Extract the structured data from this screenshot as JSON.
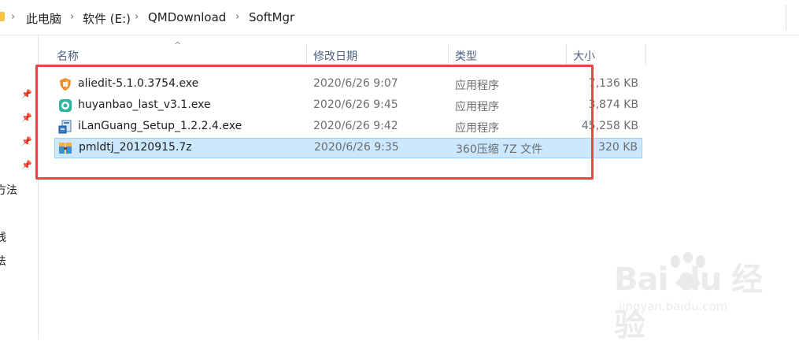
{
  "breadcrumb": {
    "items": [
      "此电脑",
      "软件 (E:)",
      "QMDownload",
      "SoftMgr"
    ],
    "separator": ">"
  },
  "columns": {
    "name": "名称",
    "date": "修改日期",
    "type": "类型",
    "size": "大小"
  },
  "files": [
    {
      "name": "aliedit-5.1.0.3754.exe",
      "date": "2020/6/26 9:07",
      "type": "应用程序",
      "size": "7,136 KB",
      "icon": "aliedit-app-icon"
    },
    {
      "name": "huyanbao_last_v3.1.exe",
      "date": "2020/6/26 9:45",
      "type": "应用程序",
      "size": "3,874 KB",
      "icon": "huyanbao-app-icon"
    },
    {
      "name": "iLanGuang_Setup_1.2.2.4.exe",
      "date": "2020/6/26 9:42",
      "type": "应用程序",
      "size": "45,258 KB",
      "icon": "installer-icon"
    },
    {
      "name": "pmldtj_20120915.7z",
      "date": "2020/6/26 9:35",
      "type": "360压缩 7Z 文件",
      "size": "320 KB",
      "icon": "archive-7z-icon",
      "selected": true
    }
  ],
  "nav": {
    "partial_labels": [
      "方法",
      "线",
      "法"
    ]
  },
  "watermark": {
    "logo": "Bai du 经验",
    "url": "jingyan.baidu.com"
  },
  "colors": {
    "selection": "#cce8ff",
    "highlight_box": "#e84545",
    "header_text": "#4d6082"
  }
}
